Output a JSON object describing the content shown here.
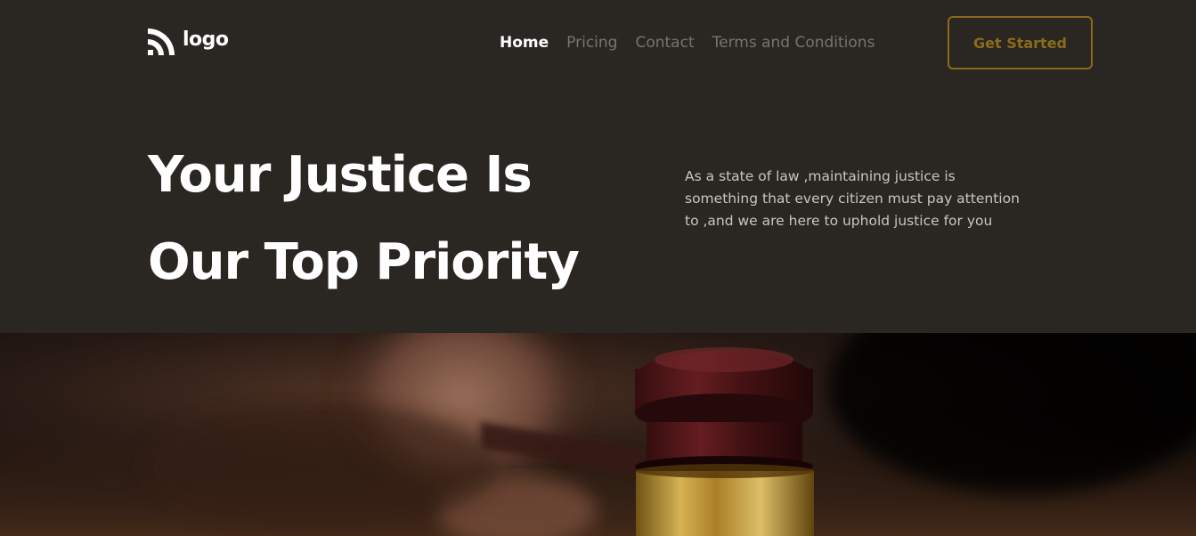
{
  "header": {
    "logo_text": "logo",
    "nav": [
      {
        "label": "Home",
        "active": true
      },
      {
        "label": "Pricing",
        "active": false
      },
      {
        "label": "Contact",
        "active": false
      },
      {
        "label": "Terms and Conditions",
        "active": false
      }
    ],
    "cta_label": "Get Started"
  },
  "hero": {
    "title_line1": "Your Justice Is",
    "title_line2": "Our Top Priority",
    "description": "As a state of law ,maintaining justice is something that every citizen must pay attention to ,and we are here to uphold justice for you"
  },
  "colors": {
    "background": "#2a2722",
    "accent": "#8a6b1c",
    "nav_inactive": "#77746e",
    "text_light": "#ffffff",
    "text_muted": "#c9c6c0"
  },
  "icons": {
    "logo": "signal-arcs-icon"
  }
}
